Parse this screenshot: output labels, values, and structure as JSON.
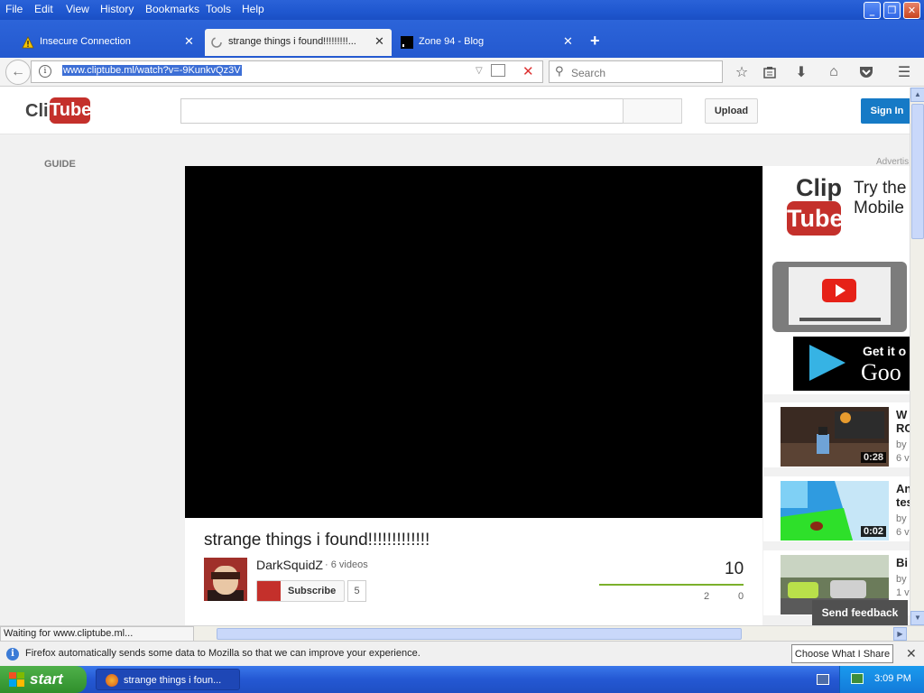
{
  "menubar": {
    "items": [
      "File",
      "Edit",
      "View",
      "History",
      "Bookmarks",
      "Tools",
      "Help"
    ],
    "window_controls": [
      "minimize-icon",
      "restore-icon",
      "close-icon"
    ]
  },
  "tabs": [
    {
      "label": "Insecure Connection",
      "icon": "warning-icon",
      "active": false
    },
    {
      "label": "strange things i found!!!!!!!!!...",
      "icon": "loading-icon",
      "active": true
    },
    {
      "label": "Zone 94 - Blog",
      "icon": "site-favicon",
      "active": false
    }
  ],
  "navbar": {
    "url": "www.cliptube.ml/watch?v=-9KunkvQz3V",
    "search_placeholder": "Search",
    "toolbar_icons": [
      "bookmark-star-icon",
      "reading-list-icon",
      "download-icon",
      "home-icon",
      "pocket-icon",
      "menu-icon"
    ]
  },
  "site": {
    "logo_clip": "Clip",
    "logo_tube": "Tube",
    "upload_label": "Upload",
    "signin_label": "Sign In",
    "guide_label": "GUIDE",
    "ad_label": "Advertis"
  },
  "video": {
    "title": "strange things i found!!!!!!!!!!!!!",
    "channel": "DarkSquidZ",
    "video_count": "· 6 videos",
    "subscribe_label": "Subscribe",
    "subscriber_count": "5",
    "views": "10",
    "likes": "2",
    "dislikes": "0"
  },
  "ad": {
    "clip": "Clip",
    "tube": "Tube",
    "text_line1": "Try the",
    "text_line2": "Mobile",
    "store_line1": "Get it o",
    "store_line2": "Goo"
  },
  "related": [
    {
      "title_line1": "W",
      "title_line2": "RC",
      "by": "by",
      "views": "6 v",
      "duration": "0:28"
    },
    {
      "title_line1": "An",
      "title_line2": "tes",
      "by": "by",
      "views": "6 v",
      "duration": "0:02"
    },
    {
      "title_line1": "Bi",
      "title_line2": "",
      "by": "by",
      "views": "1 v",
      "duration": ""
    }
  ],
  "feedback_label": "Send feedback",
  "status_text": "Waiting for www.cliptube.ml...",
  "notification": {
    "text": "Firefox automatically sends some data to Mozilla so that we can improve your experience.",
    "button_label": "Choose What I Share"
  },
  "taskbar": {
    "start_label": "start",
    "task_label": "strange things i foun...",
    "clock": "3:09 PM"
  }
}
